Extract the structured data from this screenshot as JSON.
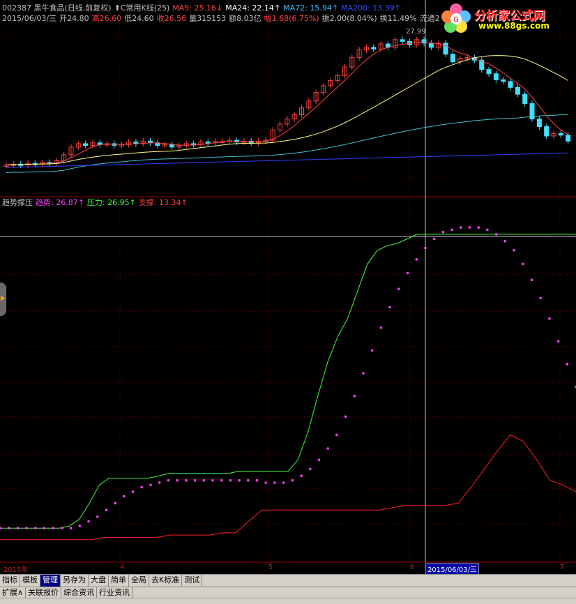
{
  "header": {
    "line1": [
      {
        "text": "002387 黑牛食品(日线,前复权)",
        "color": "#c0c0c0"
      },
      {
        "text": "⬆C常用K线(25)",
        "color": "#c0c0c0"
      },
      {
        "text": "MA5: 25.16↓",
        "color": "#ff4040"
      },
      {
        "text": "MA24: 22.14↑",
        "color": "#ffffff"
      },
      {
        "text": "MA72: 15.94↑",
        "color": "#40c0ff"
      },
      {
        "text": "MA200: 13.39↑",
        "color": "#3050ff"
      }
    ],
    "line2": [
      {
        "text": "2015/06/03/三",
        "color": "#c0c0c0"
      },
      {
        "text": "开24.80",
        "color": "#c0c0c0"
      },
      {
        "text": "高26.60",
        "color": "#ff4040"
      },
      {
        "text": "低24.60",
        "color": "#c0c0c0"
      },
      {
        "text": "收26.56",
        "color": "#ff4040"
      },
      {
        "text": "量315153",
        "color": "#c0c0c0"
      },
      {
        "text": "额8.03亿",
        "color": "#c0c0c0"
      },
      {
        "text": "幅1.68(6.75%)",
        "color": "#ff4040"
      },
      {
        "text": "振2.00(8.04%)",
        "color": "#c0c0c0"
      },
      {
        "text": "换11.49%",
        "color": "#c0c0c0"
      },
      {
        "text": "流通2",
        "color": "#c0c0c0"
      }
    ]
  },
  "logo": {
    "name": "分析家公式网",
    "url": "www.88gs.com"
  },
  "price_annotation": "27.99",
  "indicator_header": [
    {
      "text": "趋势撑压",
      "color": "#c0c0c0"
    },
    {
      "text": "趋势: 26.87↑",
      "color": "#ff40ff"
    },
    {
      "text": "压力: 26.95↑",
      "color": "#40ff40"
    },
    {
      "text": "支撑: 13.34↑",
      "color": "#ff4040"
    }
  ],
  "date_axis": {
    "labels": [
      "2015年",
      "4",
      "5",
      "6",
      "7"
    ],
    "cursor_date": "2015/06/03/三"
  },
  "tabs": [
    {
      "label": "指标",
      "active": false
    },
    {
      "label": "模板",
      "active": false
    },
    {
      "label": "管理",
      "active": true
    },
    {
      "label": "另存为",
      "active": false
    },
    {
      "label": "大盘",
      "active": false
    },
    {
      "label": "简单",
      "active": false
    },
    {
      "label": "全局",
      "active": false
    },
    {
      "label": "去K标准",
      "active": false
    },
    {
      "label": "测试",
      "active": false
    }
  ],
  "tabs2": [
    "扩展∧",
    "关联报价",
    "综合资讯",
    "行业资讯"
  ],
  "colors": {
    "up": "#ff4040",
    "down": "#40e0ff",
    "ma5": "#ff4040",
    "ma24": "#ffff80",
    "ma72": "#40c0d0",
    "ma200": "#3040ff",
    "trend": "#ff40ff",
    "pressure": "#40ff40",
    "support": "#ff2020"
  },
  "chart_data": {
    "type": "line",
    "candles_close": [
      12.1,
      12.2,
      12.1,
      12.3,
      12.2,
      12.4,
      12.3,
      12.6,
      13.3,
      14.2,
      14.6,
      14.4,
      14.7,
      14.5,
      14.6,
      14.4,
      14.5,
      14.8,
      14.6,
      14.9,
      14.7,
      14.4,
      14.5,
      14.2,
      14.4,
      14.6,
      14.5,
      14.8,
      14.7,
      14.9,
      14.9,
      15.0,
      14.8,
      14.9,
      14.7,
      14.9,
      15.0,
      16.2,
      16.9,
      17.5,
      18.0,
      18.8,
      19.6,
      20.6,
      21.4,
      22.0,
      22.6,
      23.6,
      24.7,
      25.6,
      25.9,
      25.7,
      26.3,
      25.9,
      26.8,
      26.6,
      26.2,
      26.8,
      26.4,
      25.9,
      26.4,
      25.1,
      24.2,
      24.6,
      24.7,
      24.4,
      23.3,
      22.8,
      22.1,
      21.9,
      21.2,
      20.4,
      19.3,
      17.5,
      16.6,
      15.5,
      15.8,
      15.6,
      14.9
    ],
    "trend": [
      14.0,
      14.0,
      14.0,
      14.0,
      14.0,
      14.0,
      14.0,
      14.0,
      14.0,
      14.1,
      14.3,
      14.5,
      14.8,
      15.1,
      15.4,
      15.6,
      15.8,
      15.9,
      16.0,
      16.1,
      16.1,
      16.1,
      16.1,
      16.1,
      16.1,
      16.1,
      16.1,
      16.1,
      16.1,
      16.1,
      16.0,
      16.0,
      16.0,
      16.1,
      16.3,
      16.6,
      17.0,
      17.5,
      18.1,
      18.9,
      19.8,
      20.8,
      21.8,
      22.8,
      23.7,
      24.5,
      25.2,
      25.8,
      26.3,
      26.7,
      27.0,
      27.1,
      27.2,
      27.2,
      27.2,
      27.1,
      26.9,
      26.6,
      26.2,
      25.6,
      24.9,
      24.1,
      23.2,
      22.2,
      21.2,
      20.2
    ],
    "pressure": [
      14.0,
      14.0,
      14.0,
      14.0,
      14.0,
      14.0,
      14.0,
      14.1,
      14.4,
      15.1,
      15.9,
      16.2,
      16.2,
      16.2,
      16.2,
      16.2,
      16.3,
      16.4,
      16.4,
      16.4,
      16.4,
      16.4,
      16.4,
      16.4,
      16.5,
      16.5,
      16.5,
      16.5,
      16.5,
      16.5,
      17.0,
      18.2,
      19.8,
      21.3,
      22.4,
      23.2,
      24.4,
      25.6,
      26.2,
      26.4,
      26.5,
      26.7,
      26.9,
      26.9,
      26.9,
      26.9,
      26.9,
      26.9,
      26.9,
      26.9,
      26.9,
      26.9,
      26.9,
      26.9,
      26.9,
      26.9,
      26.9,
      26.9,
      26.9
    ],
    "support": [
      13.5,
      13.5,
      13.5,
      13.5,
      13.5,
      13.5,
      13.5,
      13.5,
      13.6,
      13.6,
      13.6,
      13.6,
      13.6,
      13.7,
      13.7,
      13.7,
      13.7,
      13.8,
      13.8,
      14.3,
      14.8,
      14.8,
      14.8,
      14.8,
      14.8,
      14.8,
      14.8,
      14.8,
      14.8,
      14.8,
      14.9,
      15.0,
      15.0,
      15.0,
      15.0,
      15.1,
      15.8,
      16.6,
      17.4,
      18.1,
      17.8,
      17.0,
      16.1,
      15.9,
      15.6
    ]
  }
}
